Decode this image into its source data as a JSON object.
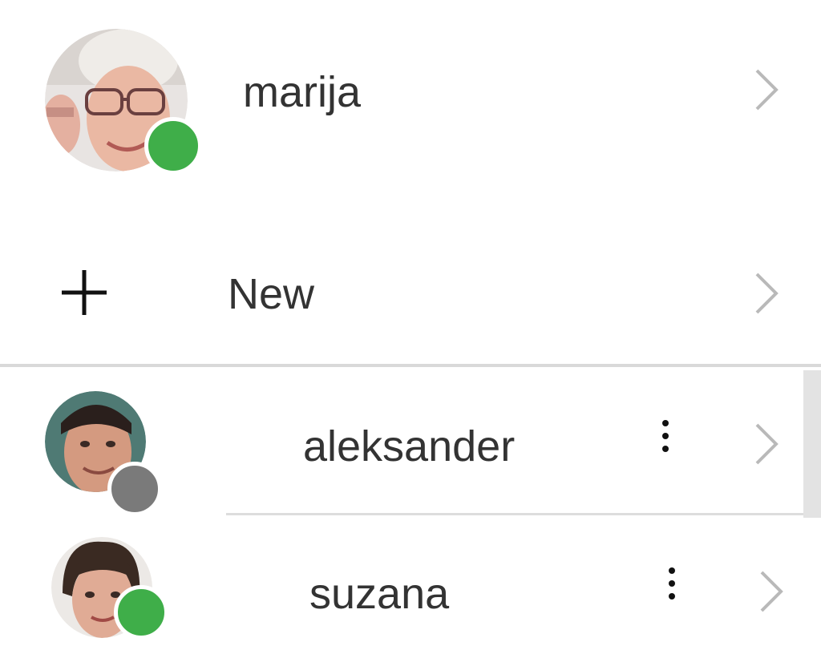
{
  "current_user": {
    "name": "marija",
    "status": "online",
    "avatar_icon": "user-photo-marija"
  },
  "new_item": {
    "label": "New",
    "icon": "plus-icon"
  },
  "contacts": [
    {
      "name": "aleksander",
      "status": "offline",
      "avatar_icon": "user-photo-aleksander"
    },
    {
      "name": "suzana",
      "status": "online",
      "avatar_icon": "user-photo-suzana"
    }
  ],
  "colors": {
    "online": "#3fae49",
    "offline": "#7a7a7a",
    "divider": "#d9d9d9",
    "text": "#333333",
    "chevron": "#b9b9b9",
    "scrollbar": "#e3e3e3"
  }
}
